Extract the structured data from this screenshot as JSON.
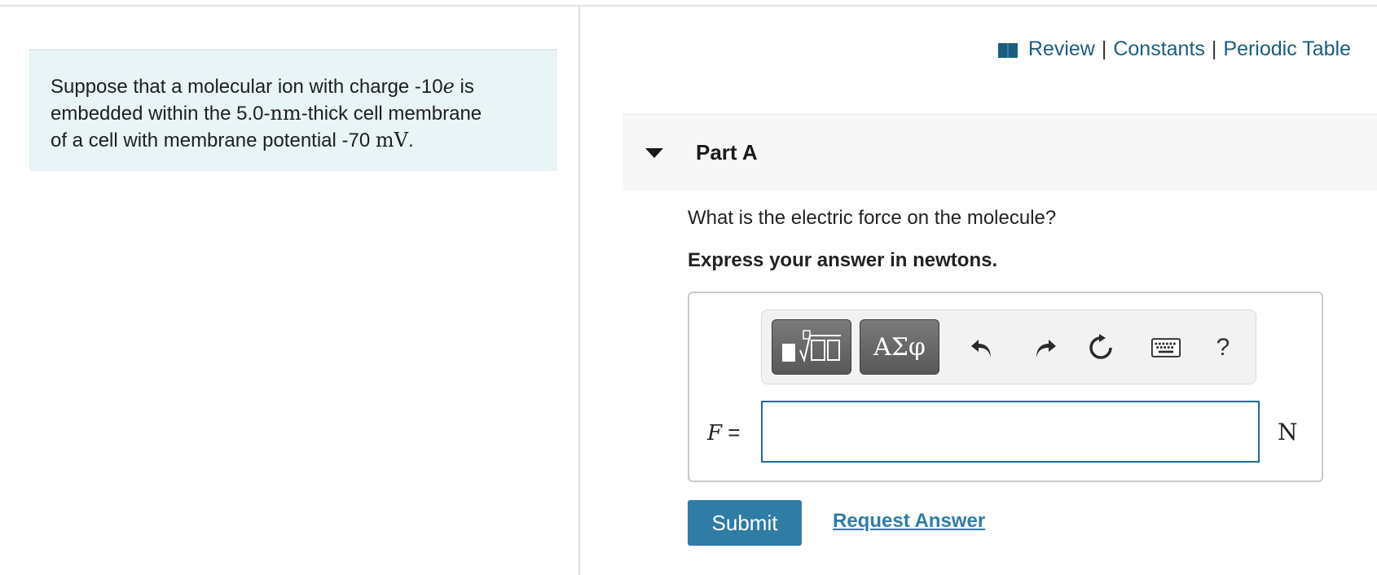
{
  "problem": {
    "line1_pre": "Suppose that a molecular ion with charge -10",
    "line1_var": "e",
    "line1_post": " is",
    "line2_pre": "embedded within the 5.0-",
    "line2_unit": "nm",
    "line2_post": "-thick cell membrane",
    "line3_pre": "of a cell with membrane potential -70 ",
    "line3_unit": "mV",
    "line3_post": "."
  },
  "resources": {
    "review": "Review",
    "separator1": "|",
    "constants": "Constants",
    "separator2": "|",
    "periodic_table": "Periodic Table"
  },
  "part": {
    "title": "Part A"
  },
  "question": "What is the electric force on the molecule?",
  "instruction": "Express your answer in newtons.",
  "toolbar": {
    "symbols_label": "ΑΣφ",
    "help_label": "?"
  },
  "answer": {
    "variable": "F",
    "equals": " =",
    "value": "",
    "unit": "N"
  },
  "actions": {
    "submit": "Submit",
    "request_answer": "Request Answer"
  },
  "colors": {
    "link": "#1b5d80",
    "button": "#2f7ca5",
    "problem_bg": "#e8f4f5",
    "input_border": "#1f6c91"
  }
}
